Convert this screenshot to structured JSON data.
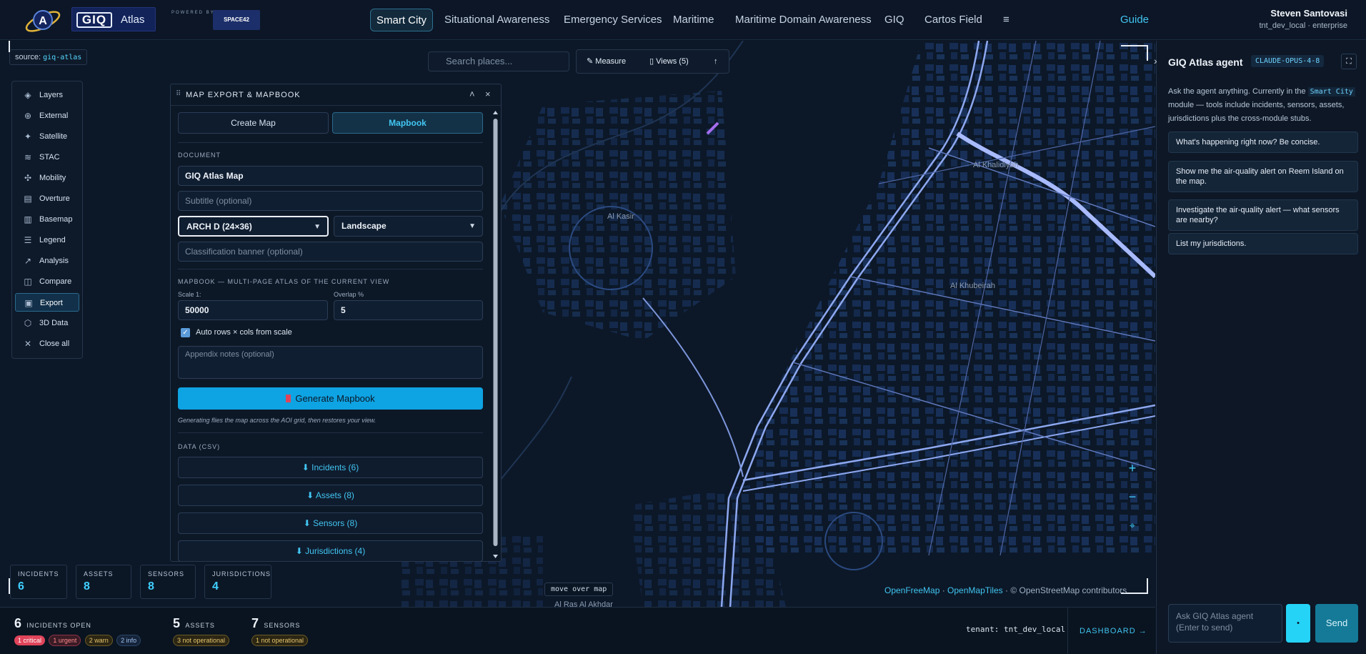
{
  "brand": {
    "name": "GIQ",
    "product": "Atlas",
    "powered_by": "POWERED BY",
    "partner": "SPACE42"
  },
  "nav": {
    "items": [
      "Smart City",
      "Situational Awareness",
      "Emergency Services",
      "Maritime",
      "Maritime Domain Awareness",
      "GIQ",
      "Cartos Field"
    ],
    "active": "Smart City",
    "menu_icon": "≡",
    "guide": "Guide"
  },
  "user": {
    "name": "Steven Santovasi",
    "tenant": "tnt_dev_local · enterprise"
  },
  "map": {
    "source_label": "source:",
    "source_value": "giq-atlas",
    "search_placeholder": "Search places...",
    "measure": "Measure",
    "views": "Views (5)",
    "move_hint": "move over map",
    "attribution": {
      "a": "OpenFreeMap",
      "b": "OpenMapTiles",
      "c": "© OpenStreetMap contributors"
    },
    "places": [
      "Al Khalidiyah",
      "Al Kasir",
      "Al Khubeirah",
      "Al Ras Al Akhdar"
    ]
  },
  "tools": [
    {
      "label": "Layers",
      "icon": "layers-icon"
    },
    {
      "label": "External",
      "icon": "globe-icon"
    },
    {
      "label": "Satellite",
      "icon": "satellite-icon"
    },
    {
      "label": "STAC",
      "icon": "stack-icon"
    },
    {
      "label": "Mobility",
      "icon": "mobility-icon"
    },
    {
      "label": "Overture",
      "icon": "overture-icon"
    },
    {
      "label": "Basemap",
      "icon": "map-icon"
    },
    {
      "label": "Legend",
      "icon": "list-icon"
    },
    {
      "label": "Analysis",
      "icon": "chart-icon"
    },
    {
      "label": "Compare",
      "icon": "compare-icon"
    },
    {
      "label": "Export",
      "icon": "export-icon",
      "active": true
    },
    {
      "label": "3D Data",
      "icon": "cube-icon"
    },
    {
      "label": "Close all",
      "icon": "close-icon"
    }
  ],
  "export_panel": {
    "title": "MAP EXPORT & MAPBOOK",
    "tab_create": "Create Map",
    "tab_mapbook": "Mapbook",
    "doc_section": "DOCUMENT",
    "title_value": "GIQ Atlas Map",
    "subtitle_placeholder": "Subtitle (optional)",
    "page_size": "ARCH D (24×36)",
    "orientation": "Landscape",
    "classification_placeholder": "Classification banner (optional)",
    "mapbook_section": "MAPBOOK — MULTI-PAGE ATLAS OF THE CURRENT VIEW",
    "scale_label": "Scale 1:",
    "scale_value": "50000",
    "overlap_label": "Overlap %",
    "overlap_value": "5",
    "auto_rows_label": "Auto rows × cols from scale",
    "auto_rows_checked": true,
    "appendix_placeholder": "Appendix notes (optional)",
    "generate_label": "Generate Mapbook",
    "generate_hint": "Generating flies the map across the AOI grid, then restores your view.",
    "data_section": "DATA (CSV)",
    "csv": [
      "⬇ Incidents (6)",
      "⬇ Assets (8)",
      "⬇ Sensors (8)",
      "⬇ Jurisdictions (4)"
    ]
  },
  "stats": [
    {
      "label": "INCIDENTS",
      "value": "6"
    },
    {
      "label": "ASSETS",
      "value": "8"
    },
    {
      "label": "SENSORS",
      "value": "8"
    },
    {
      "label": "JURISDICTIONS",
      "value": "4"
    }
  ],
  "statusbar": {
    "incidents": {
      "count": "6",
      "label": "INCIDENTS OPEN",
      "pills": [
        "1 critical",
        "1 urgent",
        "2 warn",
        "2 info"
      ]
    },
    "assets": {
      "count": "5",
      "label": "ASSETS",
      "pills": [
        "3 not operational"
      ]
    },
    "sensors": {
      "count": "7",
      "label": "SENSORS",
      "pills": [
        "1 not operational"
      ]
    },
    "tenant": "tenant: tnt_dev_local",
    "dashboard": "DASHBOARD →"
  },
  "agent": {
    "title": "GIQ Atlas agent",
    "model": "CLAUDE-OPUS-4-8",
    "intro_a": "Ask the agent anything. Currently in the ",
    "intro_code": "Smart City",
    "intro_b": " module — tools include incidents, sensors, assets, jurisdictions plus the cross-module stubs.",
    "suggestions": [
      "What's happening right now? Be concise.",
      "Show me the air-quality alert on Reem Island on the map.",
      "Investigate the air-quality alert — what sensors are nearby?",
      "List my jurisdictions."
    ],
    "input_placeholder": "Ask GIQ Atlas agent (Enter to send)",
    "send": "Send"
  },
  "colors": {
    "accent": "#40c4f0",
    "road": "#8ea8f0",
    "critical": "#e0445a",
    "warn": "#d9b04a"
  }
}
